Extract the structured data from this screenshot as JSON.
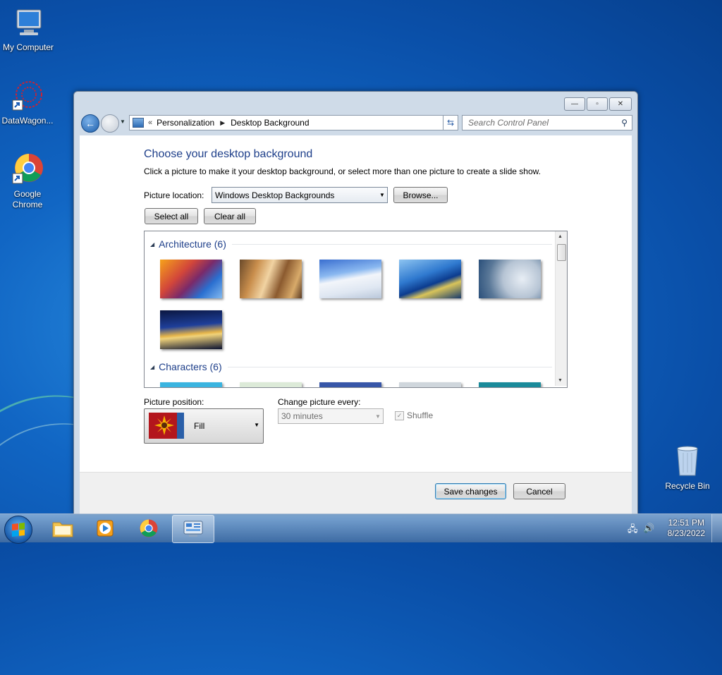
{
  "desktop": {
    "icons": [
      {
        "label": "My Computer"
      },
      {
        "label": "DataWagon..."
      },
      {
        "label": "Google Chrome"
      },
      {
        "label": "Recycle Bin"
      }
    ]
  },
  "window": {
    "controls": {
      "minimize": "—",
      "maximize": "▫",
      "close": "✕"
    },
    "address": {
      "chevron": "«",
      "crumbs": [
        "Personalization",
        "Desktop Background"
      ]
    },
    "search": {
      "placeholder": "Search Control Panel"
    }
  },
  "page": {
    "title": "Choose your desktop background",
    "description": "Click a picture to make it your desktop background, or select more than one picture to create a slide show.",
    "picture_location_label": "Picture location:",
    "picture_location_value": "Windows Desktop Backgrounds",
    "browse_label": "Browse...",
    "select_all_label": "Select all",
    "clear_all_label": "Clear all",
    "groups": [
      {
        "name": "Architecture (6)"
      },
      {
        "name": "Characters (6)"
      }
    ],
    "picture_position_label": "Picture position:",
    "picture_position_value": "Fill",
    "change_every_label": "Change picture every:",
    "change_every_value": "30 minutes",
    "shuffle_label": "Shuffle",
    "shuffle_checked": true,
    "save_label": "Save changes",
    "cancel_label": "Cancel"
  },
  "taskbar": {
    "time": "12:51 PM",
    "date": "8/23/2022"
  }
}
